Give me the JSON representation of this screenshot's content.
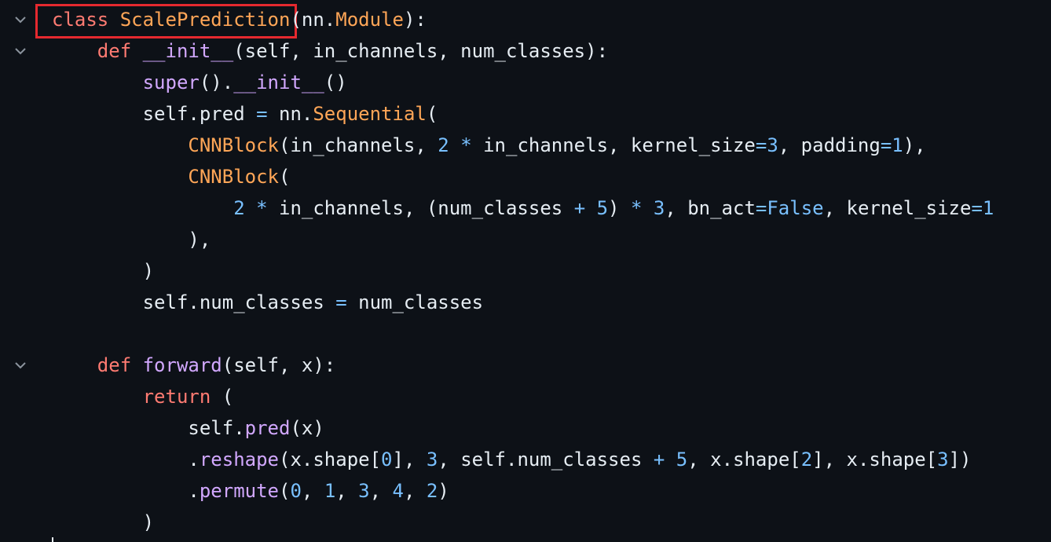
{
  "colors": {
    "background": "#0d1117",
    "keyword": "#ff7b72",
    "class_name": "#ffa657",
    "function_name": "#d2a8ff",
    "number": "#79c0ff",
    "text": "#e6edf3",
    "highlight_box": "#e5292f"
  },
  "icons": {
    "fold": "chevron-down-icon"
  },
  "highlighted_token": "class ScalePrediction",
  "lines": [
    {
      "fold": true,
      "tokens": [
        {
          "c": "kw",
          "t": "class "
        },
        {
          "c": "cls",
          "t": "ScalePrediction"
        },
        {
          "c": "plain",
          "t": "(nn."
        },
        {
          "c": "cls",
          "t": "Module"
        },
        {
          "c": "plain",
          "t": "):"
        }
      ]
    },
    {
      "fold": true,
      "tokens": [
        {
          "c": "plain",
          "t": "    "
        },
        {
          "c": "kw",
          "t": "def "
        },
        {
          "c": "fn",
          "t": "__init__"
        },
        {
          "c": "plain",
          "t": "(self, in_channels, num_classes):"
        }
      ]
    },
    {
      "fold": false,
      "tokens": [
        {
          "c": "plain",
          "t": "        "
        },
        {
          "c": "fn",
          "t": "super"
        },
        {
          "c": "plain",
          "t": "()."
        },
        {
          "c": "fn",
          "t": "__init__"
        },
        {
          "c": "plain",
          "t": "()"
        }
      ]
    },
    {
      "fold": false,
      "tokens": [
        {
          "c": "plain",
          "t": "        self.pred "
        },
        {
          "c": "op",
          "t": "="
        },
        {
          "c": "plain",
          "t": " nn."
        },
        {
          "c": "cls",
          "t": "Sequential"
        },
        {
          "c": "plain",
          "t": "("
        }
      ]
    },
    {
      "fold": false,
      "tokens": [
        {
          "c": "plain",
          "t": "            "
        },
        {
          "c": "cls",
          "t": "CNNBlock"
        },
        {
          "c": "plain",
          "t": "(in_channels, "
        },
        {
          "c": "num",
          "t": "2"
        },
        {
          "c": "plain",
          "t": " "
        },
        {
          "c": "op",
          "t": "*"
        },
        {
          "c": "plain",
          "t": " in_channels, kernel_size"
        },
        {
          "c": "op",
          "t": "="
        },
        {
          "c": "num",
          "t": "3"
        },
        {
          "c": "plain",
          "t": ", padding"
        },
        {
          "c": "op",
          "t": "="
        },
        {
          "c": "num",
          "t": "1"
        },
        {
          "c": "plain",
          "t": "),"
        }
      ]
    },
    {
      "fold": false,
      "tokens": [
        {
          "c": "plain",
          "t": "            "
        },
        {
          "c": "cls",
          "t": "CNNBlock"
        },
        {
          "c": "plain",
          "t": "("
        }
      ]
    },
    {
      "fold": false,
      "tokens": [
        {
          "c": "plain",
          "t": "                "
        },
        {
          "c": "num",
          "t": "2"
        },
        {
          "c": "plain",
          "t": " "
        },
        {
          "c": "op",
          "t": "*"
        },
        {
          "c": "plain",
          "t": " in_channels, (num_classes "
        },
        {
          "c": "op",
          "t": "+"
        },
        {
          "c": "plain",
          "t": " "
        },
        {
          "c": "num",
          "t": "5"
        },
        {
          "c": "plain",
          "t": ") "
        },
        {
          "c": "op",
          "t": "*"
        },
        {
          "c": "plain",
          "t": " "
        },
        {
          "c": "num",
          "t": "3"
        },
        {
          "c": "plain",
          "t": ", bn_act"
        },
        {
          "c": "op",
          "t": "="
        },
        {
          "c": "num",
          "t": "False"
        },
        {
          "c": "plain",
          "t": ", kernel_size"
        },
        {
          "c": "op",
          "t": "="
        },
        {
          "c": "num",
          "t": "1"
        }
      ]
    },
    {
      "fold": false,
      "tokens": [
        {
          "c": "plain",
          "t": "            ),"
        }
      ]
    },
    {
      "fold": false,
      "tokens": [
        {
          "c": "plain",
          "t": "        )"
        }
      ]
    },
    {
      "fold": false,
      "tokens": [
        {
          "c": "plain",
          "t": "        self.num_classes "
        },
        {
          "c": "op",
          "t": "="
        },
        {
          "c": "plain",
          "t": " num_classes"
        }
      ]
    },
    {
      "fold": false,
      "tokens": []
    },
    {
      "fold": true,
      "tokens": [
        {
          "c": "plain",
          "t": "    "
        },
        {
          "c": "kw",
          "t": "def "
        },
        {
          "c": "fn",
          "t": "forward"
        },
        {
          "c": "plain",
          "t": "(self, x):"
        }
      ]
    },
    {
      "fold": false,
      "tokens": [
        {
          "c": "plain",
          "t": "        "
        },
        {
          "c": "kw",
          "t": "return"
        },
        {
          "c": "plain",
          "t": " ("
        }
      ]
    },
    {
      "fold": false,
      "tokens": [
        {
          "c": "plain",
          "t": "            self."
        },
        {
          "c": "fn",
          "t": "pred"
        },
        {
          "c": "plain",
          "t": "(x)"
        }
      ]
    },
    {
      "fold": false,
      "tokens": [
        {
          "c": "plain",
          "t": "            ."
        },
        {
          "c": "fn",
          "t": "reshape"
        },
        {
          "c": "plain",
          "t": "(x.shape["
        },
        {
          "c": "num",
          "t": "0"
        },
        {
          "c": "plain",
          "t": "], "
        },
        {
          "c": "num",
          "t": "3"
        },
        {
          "c": "plain",
          "t": ", self.num_classes "
        },
        {
          "c": "op",
          "t": "+"
        },
        {
          "c": "plain",
          "t": " "
        },
        {
          "c": "num",
          "t": "5"
        },
        {
          "c": "plain",
          "t": ", x.shape["
        },
        {
          "c": "num",
          "t": "2"
        },
        {
          "c": "plain",
          "t": "], x.shape["
        },
        {
          "c": "num",
          "t": "3"
        },
        {
          "c": "plain",
          "t": "])"
        }
      ]
    },
    {
      "fold": false,
      "tokens": [
        {
          "c": "plain",
          "t": "            ."
        },
        {
          "c": "fn",
          "t": "permute"
        },
        {
          "c": "plain",
          "t": "("
        },
        {
          "c": "num",
          "t": "0"
        },
        {
          "c": "plain",
          "t": ", "
        },
        {
          "c": "num",
          "t": "1"
        },
        {
          "c": "plain",
          "t": ", "
        },
        {
          "c": "num",
          "t": "3"
        },
        {
          "c": "plain",
          "t": ", "
        },
        {
          "c": "num",
          "t": "4"
        },
        {
          "c": "plain",
          "t": ", "
        },
        {
          "c": "num",
          "t": "2"
        },
        {
          "c": "plain",
          "t": ")"
        }
      ]
    },
    {
      "fold": false,
      "tokens": [
        {
          "c": "plain",
          "t": "        )"
        }
      ]
    }
  ]
}
